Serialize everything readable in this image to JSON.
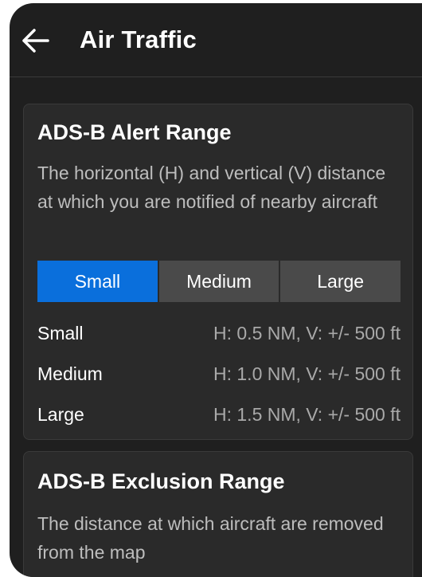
{
  "header": {
    "title": "Air Traffic",
    "back_icon": "arrow-left-icon"
  },
  "alert_range": {
    "title": "ADS-B Alert Range",
    "description": "The horizontal (H) and vertical (V) distance at which you are notified of nearby aircraft",
    "options": [
      "Small",
      "Medium",
      "Large"
    ],
    "selected": "Small",
    "rows": [
      {
        "label": "Small",
        "value": "H: 0.5 NM, V: +/- 500 ft"
      },
      {
        "label": "Medium",
        "value": "H: 1.0 NM, V: +/- 500 ft"
      },
      {
        "label": "Large",
        "value": "H: 1.5 NM, V: +/- 500 ft"
      }
    ]
  },
  "exclusion_range": {
    "title": "ADS-B Exclusion Range",
    "description": "The distance at which aircraft are removed from the map"
  },
  "colors": {
    "accent": "#0a6fdc",
    "background": "#1f1f1f",
    "card": "#2a2a2a"
  }
}
